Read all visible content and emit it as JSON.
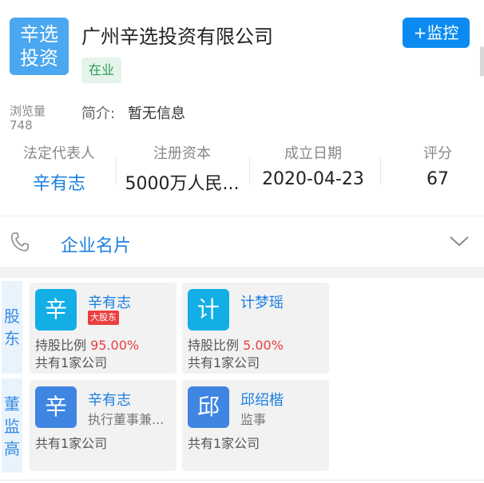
{
  "header": {
    "logo_line1": "辛选",
    "logo_line2": "投资",
    "company_name": "广州辛选投资有限公司",
    "status": "在业",
    "monitor_label": "+监控"
  },
  "meta": {
    "views_label": "浏览量",
    "views_count": "748",
    "intro_label": "简介:",
    "intro_value": "暂无信息"
  },
  "stats": [
    {
      "label": "法定代表人",
      "value": "辛有志"
    },
    {
      "label": "注册资本",
      "value": "5000万人民..."
    },
    {
      "label": "成立日期",
      "value": "2020-04-23"
    },
    {
      "label": "评分",
      "value": "67"
    }
  ],
  "business_card": {
    "label": "企业名片",
    "icon": "phone-icon"
  },
  "shareholders": {
    "section_label": "股东",
    "items": [
      {
        "avatar": "辛",
        "name": "辛有志",
        "badge": "大股东",
        "share_label": "持股比例",
        "share_pct": "95.00%",
        "companies": "共有1家公司"
      },
      {
        "avatar": "计",
        "name": "计梦瑶",
        "share_label": "持股比例",
        "share_pct": "5.00%",
        "companies": "共有1家公司"
      }
    ]
  },
  "officers": {
    "section_label": "董监高",
    "items": [
      {
        "avatar": "辛",
        "name": "辛有志",
        "role": "执行董事兼...",
        "companies": "共有1家公司"
      },
      {
        "avatar": "邱",
        "name": "邱绍楷",
        "role": "监事",
        "companies": "共有1家公司"
      }
    ]
  },
  "colors": {
    "accent": "#0b8bf2",
    "link": "#1a7fe0",
    "status_green": "#2e9a55",
    "red": "#ea4040",
    "avatar_cyan": "#13aee6",
    "avatar_blue": "#3f85e2"
  }
}
